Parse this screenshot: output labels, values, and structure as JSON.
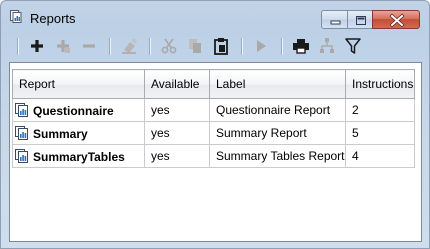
{
  "window": {
    "title": "Reports",
    "minimize_label": "Minimize",
    "maximize_label": "Maximize",
    "close_label": "Close"
  },
  "toolbar": {
    "buttons": [
      {
        "name": "add-button",
        "icon": "plus-icon",
        "enabled": true
      },
      {
        "name": "add-child-button",
        "icon": "plus-green-icon",
        "enabled": false
      },
      {
        "name": "remove-button",
        "icon": "minus-icon",
        "enabled": false
      },
      {
        "name": "edit-button",
        "icon": "eraser-icon",
        "enabled": false
      },
      {
        "name": "cut-button",
        "icon": "scissors-icon",
        "enabled": false
      },
      {
        "name": "copy-button",
        "icon": "copy-icon",
        "enabled": false
      },
      {
        "name": "paste-button",
        "icon": "clipboard-icon",
        "enabled": true
      },
      {
        "name": "run-button",
        "icon": "play-icon",
        "enabled": false
      },
      {
        "name": "print-button",
        "icon": "printer-icon",
        "enabled": true
      },
      {
        "name": "hierarchy-button",
        "icon": "tree-icon",
        "enabled": false
      },
      {
        "name": "filter-button",
        "icon": "funnel-icon",
        "enabled": true
      }
    ]
  },
  "table": {
    "columns": [
      "Report",
      "Available",
      "Label",
      "Instructions"
    ],
    "rows": [
      {
        "report": "Questionnaire",
        "available": "yes",
        "label": "Questionnaire Report",
        "instructions": "2",
        "selected": true
      },
      {
        "report": "Summary",
        "available": "yes",
        "label": "Summary Report",
        "instructions": "5",
        "selected": false
      },
      {
        "report": "SummaryTables",
        "available": "yes",
        "label": "Summary Tables Report",
        "instructions": "4",
        "selected": false
      }
    ]
  },
  "colors": {
    "window_frame": "#c3d3e6",
    "close_button": "#c44d36",
    "icon_enabled": "#1a1a1a",
    "icon_disabled": "#a7a7a7"
  }
}
